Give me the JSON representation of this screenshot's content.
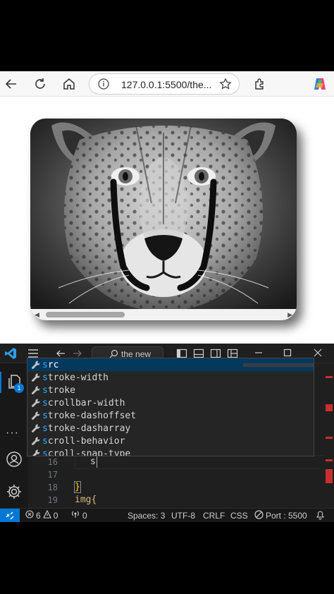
{
  "browser": {
    "url": "127.0.0.1:5500/the...",
    "image_alt": "Black and white cheetah portrait"
  },
  "vscode": {
    "search_label": "the new",
    "notification_count": "1",
    "suggestions": [
      {
        "label": "src",
        "match": "s",
        "rest": "rc"
      },
      {
        "label": "stroke-width",
        "match": "s",
        "rest": "troke-width"
      },
      {
        "label": "stroke",
        "match": "s",
        "rest": "troke"
      },
      {
        "label": "scrollbar-width",
        "match": "s",
        "rest": "crollbar-width"
      },
      {
        "label": "stroke-dashoffset",
        "match": "s",
        "rest": "troke-dashoffset"
      },
      {
        "label": "stroke-dasharray",
        "match": "s",
        "rest": "troke-dasharray"
      },
      {
        "label": "scroll-behavior",
        "match": "s",
        "rest": "croll-behavior"
      },
      {
        "label": "scroll-snap-type",
        "match": "s",
        "rest": "croll-snap-type"
      }
    ],
    "lines": [
      {
        "num": "16",
        "text": "s"
      },
      {
        "num": "17",
        "text": ""
      },
      {
        "num": "18",
        "text": "}"
      },
      {
        "num": "19",
        "text": "img{"
      }
    ],
    "status": {
      "errors": "6",
      "warnings": "0",
      "ports_forwarded": "0",
      "spaces": "Spaces: 3",
      "encoding": "UTF-8",
      "eol": "CRLF",
      "language": "CSS",
      "port": "Port : 5500"
    }
  },
  "colors": {
    "vscode_blue": "#0078d4",
    "suggest_highlight": "#2aaaff",
    "brace_yellow": "#ffd700"
  }
}
